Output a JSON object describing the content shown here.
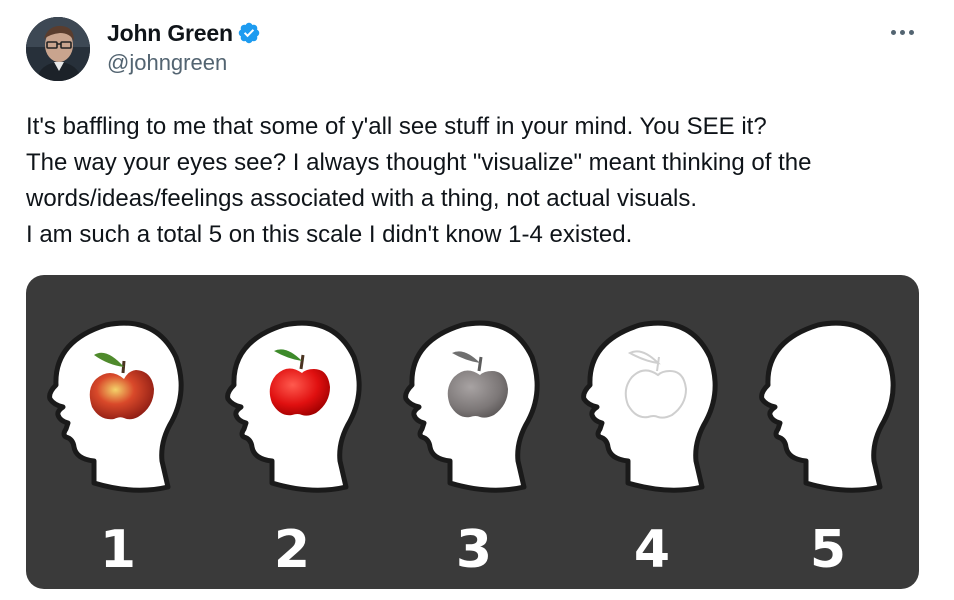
{
  "author": {
    "display_name": "John Green",
    "handle": "@johngreen",
    "verified": true,
    "verified_badge_color": "#1d9bf0"
  },
  "icons": {
    "avatar": "user-avatar-photo",
    "verified": "verified-badge-icon",
    "more": "more-options-icon"
  },
  "tweet": {
    "text_lines": [
      "It's baffling to me that some of y'all see stuff in your mind. You SEE it?",
      "The way your eyes see? I always thought \"visualize\" meant thinking of the",
      "words/ideas/feelings associated with a thing, not actual visuals.",
      "I am such a total 5 on this scale I didn't know 1-4 existed."
    ]
  },
  "media": {
    "background_color": "#3a3a3a",
    "panels": [
      {
        "number": "1",
        "apple": "realistic-color"
      },
      {
        "number": "2",
        "apple": "red-flat"
      },
      {
        "number": "3",
        "apple": "grey"
      },
      {
        "number": "4",
        "apple": "outline"
      },
      {
        "number": "5",
        "apple": "none"
      }
    ]
  }
}
